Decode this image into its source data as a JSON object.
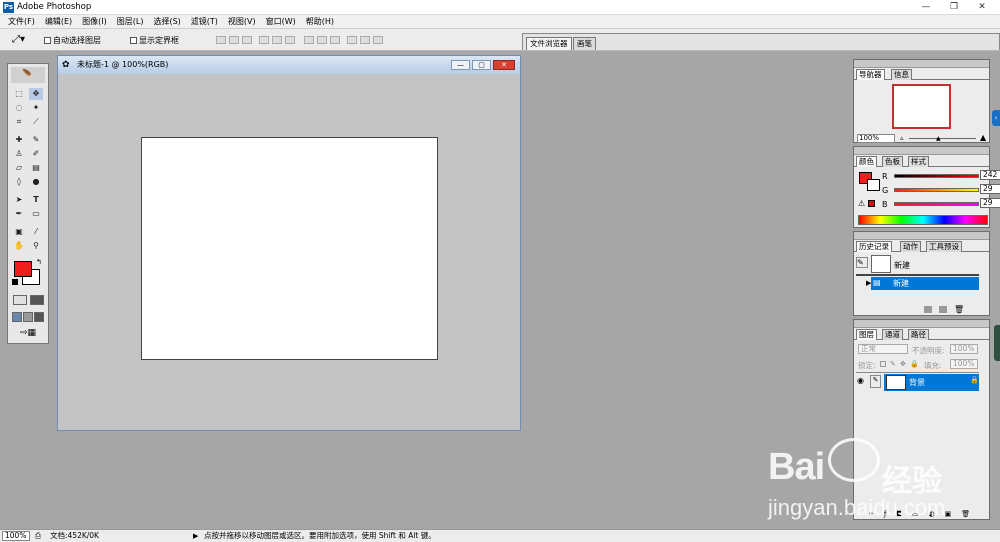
{
  "app": {
    "title": "Adobe Photoshop",
    "logo": "Ps"
  },
  "window_controls": {
    "minimize": "—",
    "restore": "❐",
    "close": "✕"
  },
  "menu": [
    "文件(F)",
    "编辑(E)",
    "图像(I)",
    "图层(L)",
    "选择(S)",
    "滤镜(T)",
    "视图(V)",
    "窗口(W)",
    "帮助(H)"
  ],
  "options": {
    "tool_icon": "move-tool-icon",
    "auto_select": "自动选择图层",
    "show_bounds": "显示定界框"
  },
  "top_tabs": {
    "file_browser": "文件浏览器",
    "brushes": "画笔"
  },
  "document": {
    "title": "未标题-1 @ 100%(RGB)"
  },
  "navigator": {
    "tab1": "导航器",
    "tab2": "信息",
    "zoom": "100%"
  },
  "color": {
    "tab1": "颜色",
    "tab2": "色板",
    "tab3": "样式",
    "r_label": "R",
    "g_label": "G",
    "b_label": "B",
    "r": "242",
    "g": "29",
    "b": "29",
    "foreground": "#f21d1d",
    "background": "#ffffff"
  },
  "history": {
    "tab1": "历史记录",
    "tab2": "动作",
    "tab3": "工具预设",
    "snapshot_label": "新建",
    "state_label": "新建"
  },
  "layers": {
    "tab1": "图层",
    "tab2": "通道",
    "tab3": "路径",
    "blend_mode": "正常",
    "opacity_label": "不透明度:",
    "opacity": "100%",
    "lock_label": "锁定:",
    "fill_label": "填充:",
    "fill": "100%",
    "layer_name": "背景"
  },
  "status": {
    "zoom": "100%",
    "doc_info": "文档:452K/0K",
    "hint": "点按并拖移以移动图层或选区。要用附加选项，使用 Shift 和 Alt 键。"
  },
  "watermark": {
    "brand_left": "Bai",
    "brand_right": "经验",
    "url": "jingyan.baidu.com"
  }
}
